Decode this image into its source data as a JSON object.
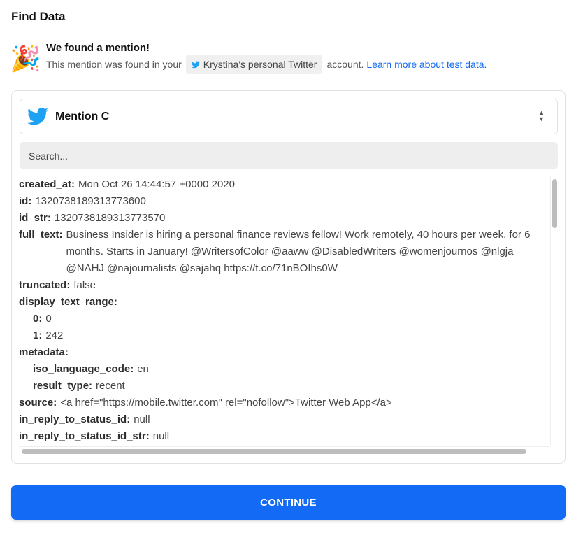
{
  "header": {
    "title": "Find Data"
  },
  "notice": {
    "icon": "party-popper-icon",
    "heading": "We found a mention!",
    "text_before": "This mention was found in your",
    "account": "Krystina's personal Twitter",
    "text_after": "account.",
    "link": "Learn more about test data."
  },
  "selector": {
    "icon": "twitter-icon",
    "value": "Mention C"
  },
  "search": {
    "placeholder": "Search..."
  },
  "fields": [
    {
      "key": "created_at:",
      "value": "Mon Oct 26 14:44:57 +0000 2020",
      "indent": 0
    },
    {
      "key": "id:",
      "value": "1320738189313773600",
      "indent": 0
    },
    {
      "key": "id_str:",
      "value": "1320738189313773570",
      "indent": 0
    },
    {
      "key": "full_text:",
      "value": "Business Insider is hiring a personal finance reviews fellow! Work remotely, 40 hours per week, for 6 months. Starts in January! @WritersofColor @aaww @DisabledWriters @womenjournos @nlgja @NAHJ @najournalists @sajahq https://t.co/71nBOIhs0W",
      "indent": 0
    },
    {
      "key": "truncated:",
      "value": "false",
      "indent": 0
    },
    {
      "key": "display_text_range:",
      "value": "",
      "indent": 0
    },
    {
      "key": "0:",
      "value": "0",
      "indent": 1
    },
    {
      "key": "1:",
      "value": "242",
      "indent": 1
    },
    {
      "key": "metadata:",
      "value": "",
      "indent": 0
    },
    {
      "key": "iso_language_code:",
      "value": "en",
      "indent": 1
    },
    {
      "key": "result_type:",
      "value": "recent",
      "indent": 1
    },
    {
      "key": "source:",
      "value": "<a href=\"https://mobile.twitter.com\" rel=\"nofollow\">Twitter Web App</a>",
      "indent": 0
    },
    {
      "key": "in_reply_to_status_id:",
      "value": "null",
      "indent": 0
    },
    {
      "key": "in_reply_to_status_id_str:",
      "value": "null",
      "indent": 0
    }
  ],
  "footer": {
    "continue_label": "CONTINUE"
  },
  "colors": {
    "accent": "#136bf5",
    "twitter": "#1da1f2"
  }
}
